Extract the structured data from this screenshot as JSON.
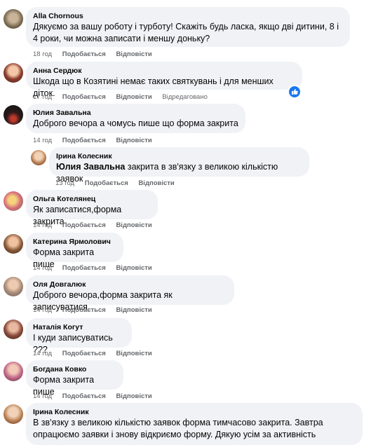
{
  "labels": {
    "like": "Подобається",
    "reply": "Відповісти",
    "edited": "Відредаговано"
  },
  "comments": [
    {
      "author": "Alla Chornous",
      "text": "Дякуємо за вашу роботу і турботу! Скажіть будь ласка, якщо дві дитини, 8 і 4 роки, чи можна записати і меншу доньку?",
      "time": "18 год"
    },
    {
      "author": "Анна Сердюк",
      "text": "Шкода що в Козятині немає таких святкувань і для менших діток.",
      "time": "17 год"
    },
    {
      "author": "Юлия Завальна",
      "text": "Доброго вечора а чомусь пише що форма закрита",
      "time": "14 год"
    },
    {
      "author": "Ірина Колесник",
      "mention": "Юлия Завальна",
      "text": " закрита в зв'язку з великою кількістю заявок",
      "time": "13 год"
    },
    {
      "author": "Ольга Котелянец",
      "text": "Як записатися,форма закрита",
      "time": "14 год"
    },
    {
      "author": "Катерина Ярмолович",
      "text": "Форма закрита пише",
      "time": "14 год"
    },
    {
      "author": "Оля Довгалюк",
      "text": "Доброго вечора,форма закрита як записуватися",
      "time": "14 год"
    },
    {
      "author": "Наталія Когут",
      "text": "І куди записуватись ???",
      "time": "14 год"
    },
    {
      "author": "Богдана Ковко",
      "text": "Форма закрита пише",
      "time": "14 год"
    },
    {
      "author": "Ірина Колесник",
      "text": "В зв'язку з великою кількістю заявок форма тимчасово закрита. Завтра опрацюємо заявки і знову відкриємо форму. Дякую усім за активність"
    }
  ],
  "colors": {
    "bubble": "#f0f2f5",
    "meta": "#65676b",
    "like_blue": "#1877f2"
  },
  "icons": {
    "reaction": "like-thumb-icon"
  }
}
